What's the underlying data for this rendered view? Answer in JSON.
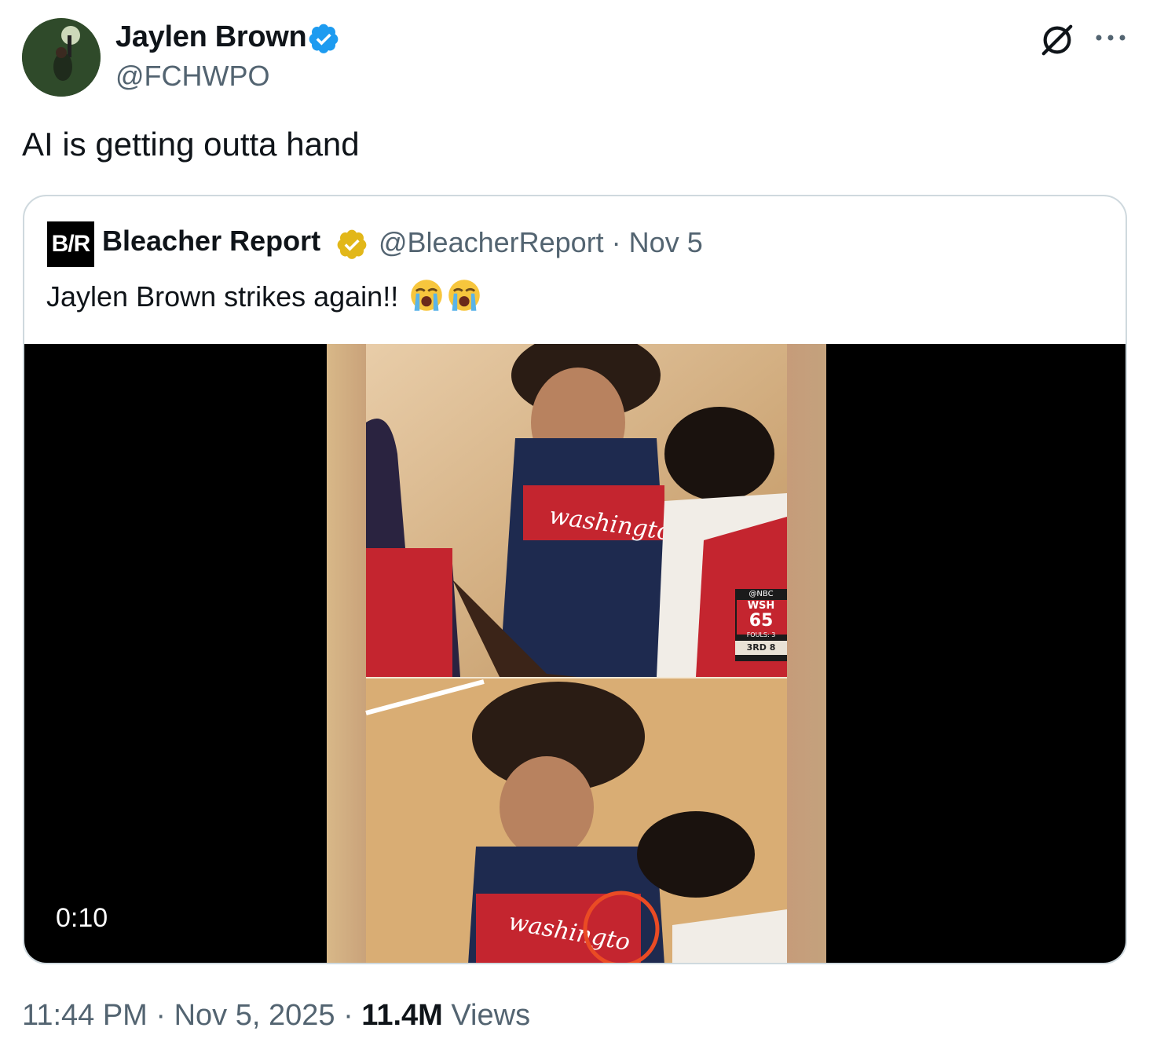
{
  "author": {
    "name": "Jaylen Brown",
    "handle": "@FCHWPO",
    "verified": true,
    "badge_color": "#1d9bf0"
  },
  "actions": {
    "grok_icon": "grok-icon",
    "more_icon": "more-icon"
  },
  "tweet": {
    "text": "AI is getting outta hand"
  },
  "quoted": {
    "logo_text": "B/R",
    "name": "Bleacher Report",
    "badge_color": "#e2b719",
    "handle_date": "@BleacherReport · Nov 5",
    "text": "Jaylen Brown strikes again!!",
    "emoji": [
      "loudly-crying-face",
      "loudly-crying-face"
    ],
    "video": {
      "duration": "0:10",
      "scoreboard": {
        "network": "@NBC",
        "team": "WSH",
        "score": "65",
        "fouls": "FOULS: 3",
        "period": "3RD",
        "clock": "8"
      }
    }
  },
  "meta": {
    "time_date": "11:44 PM · Nov 5, 2025 · ",
    "views_count": "11.4M",
    "views_label": " Views"
  }
}
